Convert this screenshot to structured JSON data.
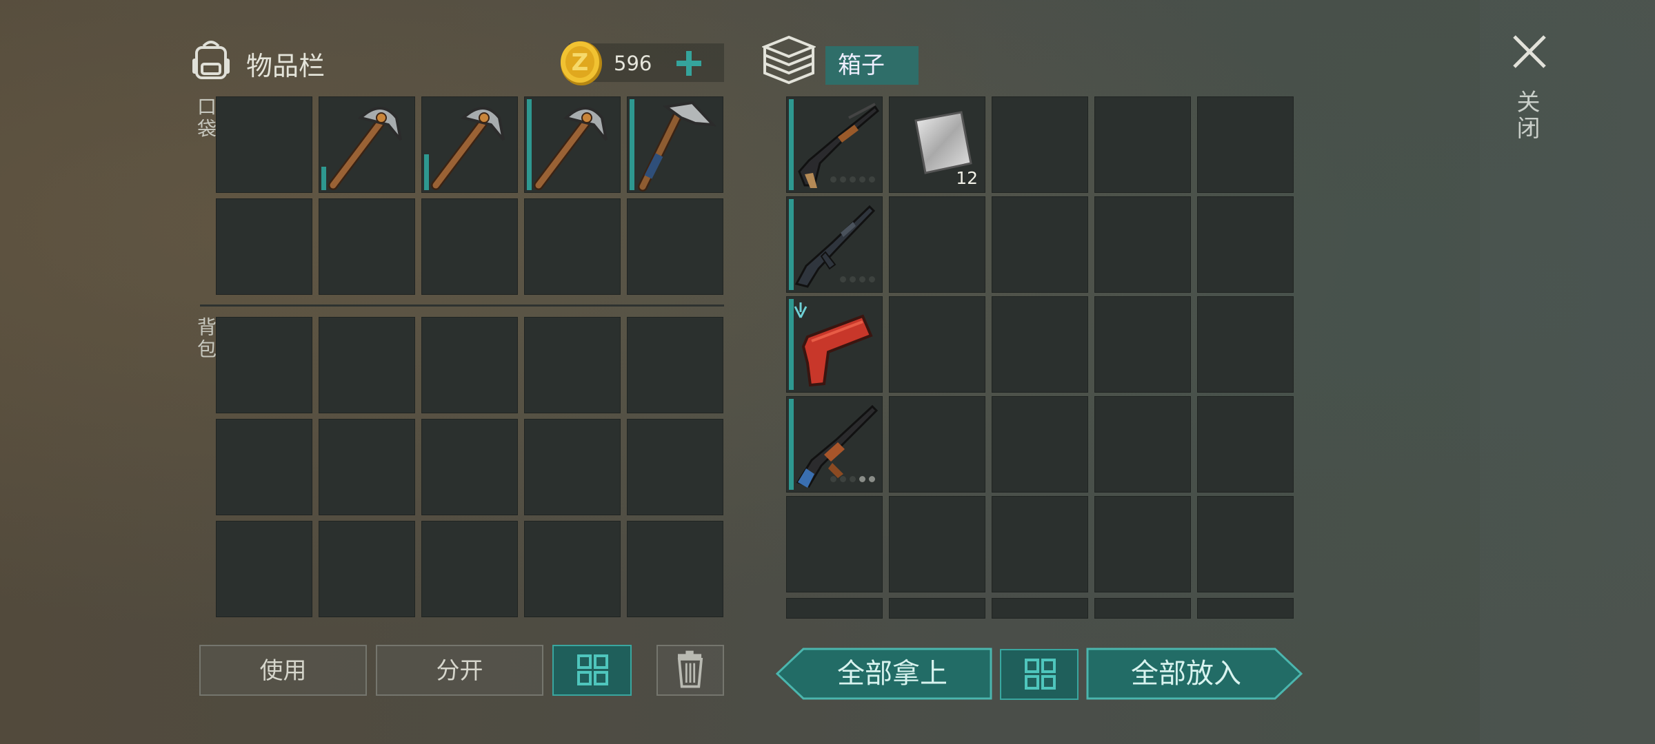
{
  "inventory": {
    "title": "物品栏",
    "coins": "596",
    "pocket_label": "口袋",
    "backpack_label": "背包"
  },
  "box": {
    "title": "箱子"
  },
  "close_label": "关闭",
  "pocket_slots": [
    {
      "item": "empty"
    },
    {
      "item": "stone-pickaxe",
      "durability": 0.25
    },
    {
      "item": "stone-pickaxe",
      "durability": 0.38
    },
    {
      "item": "stone-pickaxe",
      "durability": 1.0
    },
    {
      "item": "iron-hammer",
      "durability": 1.0
    }
  ],
  "box_items": [
    {
      "item": "pump-shotgun",
      "row": 0,
      "dots": 5,
      "dots_on": 0
    },
    {
      "item": "metal-plate",
      "row": 0,
      "col": 1,
      "quantity": "12"
    },
    {
      "item": "m16-rifle",
      "row": 1,
      "dots": 4,
      "dots_on": 0
    },
    {
      "item": "flare-gun",
      "row": 2
    },
    {
      "item": "ak-rifle",
      "row": 3,
      "dots": 5,
      "dots_on": 2
    }
  ],
  "buttons": {
    "use": "使用",
    "split": "分开",
    "take_all": "全部拿上",
    "put_all": "全部放入"
  },
  "colors": {
    "accent": "#2f6e69",
    "teal": "#39a7a0",
    "slot": "#2b302e"
  }
}
